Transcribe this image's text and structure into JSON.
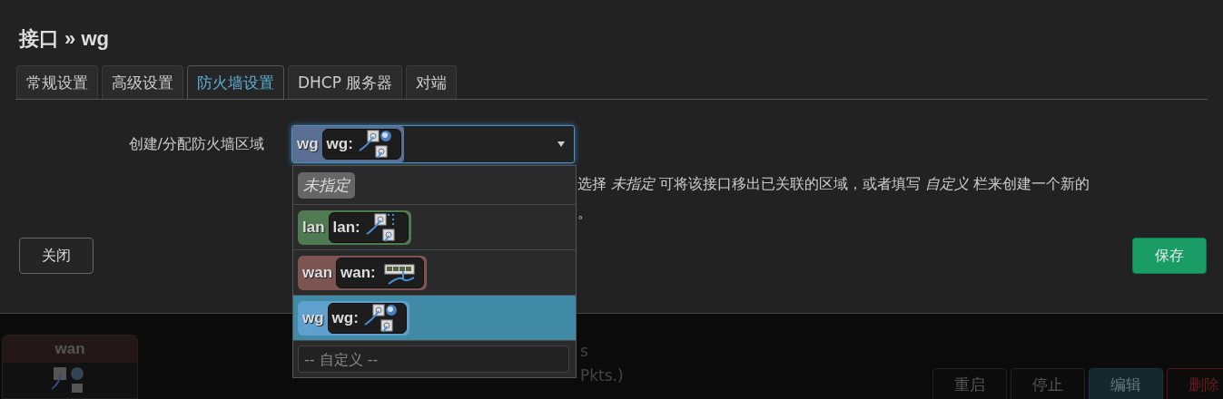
{
  "dialog": {
    "title": "接口 » wg",
    "tabs": [
      {
        "label": "常规设置",
        "selected": false
      },
      {
        "label": "高级设置",
        "selected": false
      },
      {
        "label": "防火墙设置",
        "selected": true
      },
      {
        "label": "DHCP 服务器",
        "selected": false
      },
      {
        "label": "对端",
        "selected": false
      }
    ],
    "field": {
      "label": "创建/分配防火墙区域",
      "value": {
        "zone": "wg",
        "color": "#5a6f94",
        "device": {
          "name": "wg:",
          "kind": "tunnel"
        }
      },
      "options": [
        {
          "kind": "none",
          "label": "未指定",
          "selected": false
        },
        {
          "kind": "zone",
          "zone": "lan",
          "color": "#4f7a52",
          "device": {
            "name": "lan:",
            "kind": "bridge"
          },
          "selected": false
        },
        {
          "kind": "zone",
          "zone": "wan",
          "color": "#7c5452",
          "device": {
            "name": "wan:",
            "kind": "switch"
          },
          "selected": false
        },
        {
          "kind": "zone",
          "zone": "wg",
          "color": "#5fa0cf",
          "device": {
            "name": "wg:",
            "kind": "tunnel"
          },
          "selected": true
        },
        {
          "kind": "custom",
          "placeholder": "-- 自定义 --",
          "selected": false
        }
      ],
      "description": [
        "选择 *未指定* 可将该接口移出已关联的区域，或者填写 *自定义* 栏来创建一个新的",
        "。"
      ]
    },
    "buttons": [
      {
        "label": "关闭",
        "kind": "plain"
      },
      {
        "label": "保存",
        "kind": "primary"
      }
    ]
  },
  "background": {
    "card_title": "wan",
    "texts": [
      "s",
      "Pkts.)"
    ],
    "buttons": [
      {
        "label": "重启",
        "kind": "plain"
      },
      {
        "label": "停止",
        "kind": "plain"
      },
      {
        "label": "编辑",
        "kind": "edit"
      },
      {
        "label": "删除",
        "kind": "delete"
      }
    ]
  }
}
